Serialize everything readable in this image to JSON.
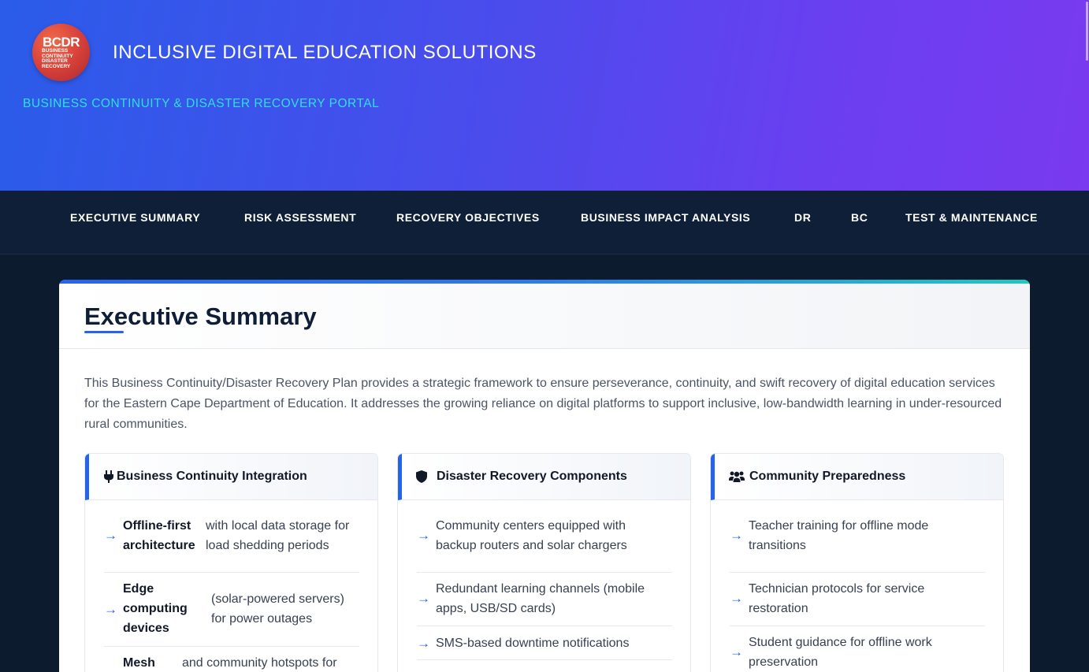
{
  "header": {
    "logo": {
      "big": "BCDR",
      "small_lines": [
        "BUSINESS",
        "CONTINUITY",
        "DISASTER",
        "RECOVERY"
      ]
    },
    "title": "INCLUSIVE DIGITAL EDUCATION SOLUTIONS",
    "subtitle": "BUSINESS CONTINUITY & DISASTER RECOVERY PORTAL"
  },
  "nav": {
    "items": [
      {
        "label": "EXECUTIVE SUMMARY"
      },
      {
        "label": "RISK ASSESSMENT"
      },
      {
        "label": "RECOVERY OBJECTIVES"
      },
      {
        "label": "BUSINESS IMPACT ANALYSIS"
      },
      {
        "label": "DR"
      },
      {
        "label": "BC"
      },
      {
        "label": "TEST & MAINTENANCE"
      }
    ]
  },
  "section": {
    "title": "Executive Summary",
    "intro": "This Business Continuity/Disaster Recovery Plan provides a strategic framework to ensure perseverance, continuity, and swift recovery of digital education services for the Eastern Cape Department of Education. It addresses the growing reliance on digital platforms to support inclusive, low-bandwidth learning in under-resourced rural communities."
  },
  "panels": [
    {
      "icon": "plug-icon",
      "title": "Business Continuity Integration",
      "items": [
        {
          "bold": "Offline-first architecture",
          "rest": "with local data storage for load shedding periods"
        },
        {
          "bold": "Edge computing devices",
          "rest": "(solar-powered servers) for power outages"
        },
        {
          "bold": "Mesh",
          "rest": "and community hotspots for"
        }
      ]
    },
    {
      "icon": "shield-icon",
      "title": "Disaster Recovery Components",
      "items": [
        {
          "text": "Community centers equipped with backup routers and solar chargers"
        },
        {
          "text": "Redundant learning channels (mobile apps, USB/SD cards)"
        },
        {
          "text": "SMS-based downtime notifications"
        }
      ]
    },
    {
      "icon": "users-icon",
      "title": "Community Preparedness",
      "items": [
        {
          "text": "Teacher training for offline mode transitions"
        },
        {
          "text": "Technician protocols for service restoration"
        },
        {
          "text": "Student guidance for offline work preservation"
        }
      ]
    }
  ],
  "colors": {
    "accent": "#2563eb",
    "teal": "#2ee0e6",
    "nav_bg": "#0f1f38"
  }
}
